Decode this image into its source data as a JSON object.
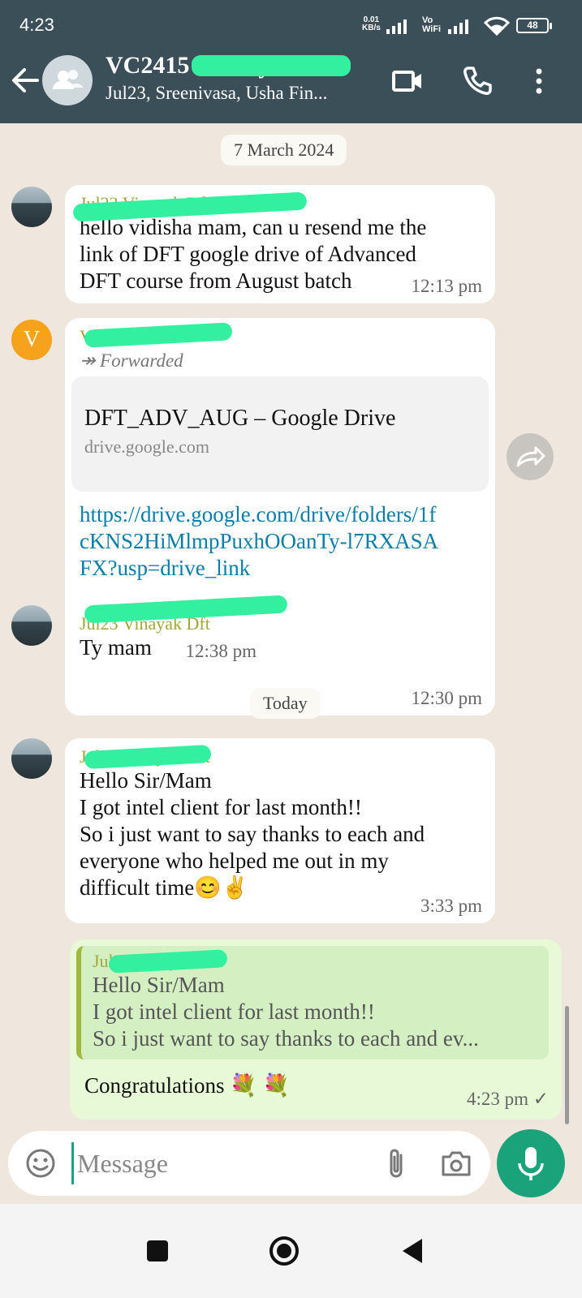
{
  "status_bar": {
    "time": "4:23",
    "net_speed_value": "0.01",
    "net_speed_unit": "KB/s",
    "vowifi_top": "Vo",
    "vowifi_bottom": "WiFi",
    "battery": "48"
  },
  "header": {
    "title": "VC2415 - Vinayak D...",
    "subtitle": "Jul23, Sreenivasa, Usha Fin..."
  },
  "chat": {
    "date_1": "7 March 2024",
    "date_2": "Today",
    "messages": [
      {
        "sender": "Jul23 Vinayak Dft",
        "text": "hello vidisha mam, can u resend me the link of DFT google drive of Advanced DFT course from August batch",
        "time": "12:13 pm"
      },
      {
        "sender": "Vc21 - Vidisha",
        "forwarded_label": "Forwarded",
        "link_title": "DFT_ADV_AUG – Google Drive",
        "link_domain": "drive.google.com",
        "url": "https://drive.google.com/drive/folders/1fcKNS2HiMlmpPuxhOOanTy-l7RXASAFX?usp=drive_link",
        "time": "12:30 pm"
      },
      {
        "sender": "Jul23 Vinayak Dft",
        "text": "Ty mam",
        "time": "12:38 pm"
      },
      {
        "sender": "Jul23 Vinayak Dft",
        "text_lines": [
          "Hello Sir/Mam",
          "I got intel client for last month!!",
          "So i just want to say thanks to each and",
          "everyone who helped me out in my",
          "difficult time😊✌️"
        ],
        "time": "3:33 pm"
      },
      {
        "quote_sender": "Jul23 Vinayak Dft",
        "quote_lines": [
          "Hello Sir/Mam",
          "I got intel client for last month!!",
          "So i just want to say thanks to each and ev..."
        ],
        "text": "Congratulations 💐 💐",
        "time": "4:23 pm ✓"
      }
    ]
  },
  "input": {
    "placeholder": "Message"
  },
  "avatar_letter": "V",
  "colors": {
    "header_bg": "#3b4f59",
    "chat_bg": "#efe7dd",
    "outgoing_bubble": "#e7f9d6",
    "accent_green": "#1aa37a",
    "link_blue": "#0a7da8",
    "sender_color": "#a0a83c"
  },
  "icons": {
    "back": "arrow-left-icon",
    "video": "video-call-icon",
    "call": "phone-icon",
    "menu": "more-vert-icon",
    "emoji": "emoji-icon",
    "attach": "paperclip-icon",
    "camera": "camera-icon",
    "mic": "mic-icon",
    "share": "share-forward-icon"
  }
}
